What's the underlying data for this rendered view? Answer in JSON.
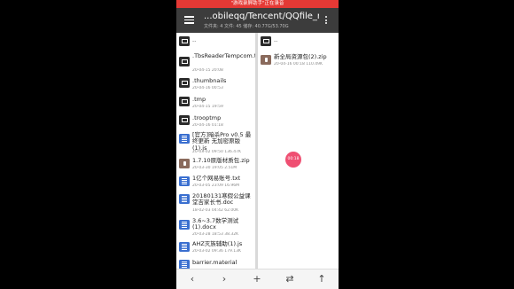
{
  "recording_banner": "\"游戏录屏助手\"正在录音",
  "toolbar": {
    "path": "...obileqq/Tencent/QQfile_recv/",
    "summary": "文件夹: 4 文件: 45 储存: 40.77G/53.70G"
  },
  "left_pane": {
    "parent": "..",
    "items": [
      {
        "type": "folder",
        "name": ".TbsReaderTempcom.tencent.mobileqq",
        "meta": "20-04-15 20:08"
      },
      {
        "type": "folder",
        "name": ".thumbnails",
        "meta": "20-04-16 00:53"
      },
      {
        "type": "folder",
        "name": ".tmp",
        "meta": "20-04-15 19:59"
      },
      {
        "type": "folder",
        "name": ".trooptmp",
        "meta": "20-04-16 01:18"
      },
      {
        "type": "doc",
        "name": "[官方]暗杀Pro v0.5 最终更新 无加密原版(1).js",
        "meta": "20-03-02 09:50  136.47K"
      },
      {
        "type": "zip",
        "name": "1.7.10原版材质包.zip",
        "meta": "20-03-30 19:05  2.51M"
      },
      {
        "type": "doc",
        "name": "1亿个网易账号.txt",
        "meta": "20-03-05 23:09  16.96M"
      },
      {
        "type": "doc",
        "name": "20180131寒假公益课堂吉家长书.doc",
        "meta": "18-02-03 04:42  62.00K"
      },
      {
        "type": "doc",
        "name": "3.6~3.7数学测试(1).docx",
        "meta": "20-03-28 18:53  38.32K"
      },
      {
        "type": "doc",
        "name": "AHZ灭族辅助(1).js",
        "meta": "20-03-02 09:36  179.13K"
      },
      {
        "type": "doc",
        "name": "barrier.material",
        "meta": ""
      }
    ]
  },
  "right_pane": {
    "parent": "..",
    "items": [
      {
        "type": "zip",
        "name": "新全局资源包(2).zip",
        "meta": "20-04-16 00:18  110.49K"
      }
    ]
  },
  "fab_label": "00:18",
  "bottom_bar": {
    "back": "‹",
    "forward": "›",
    "add": "+",
    "swap": "⇄",
    "up": "↑"
  }
}
